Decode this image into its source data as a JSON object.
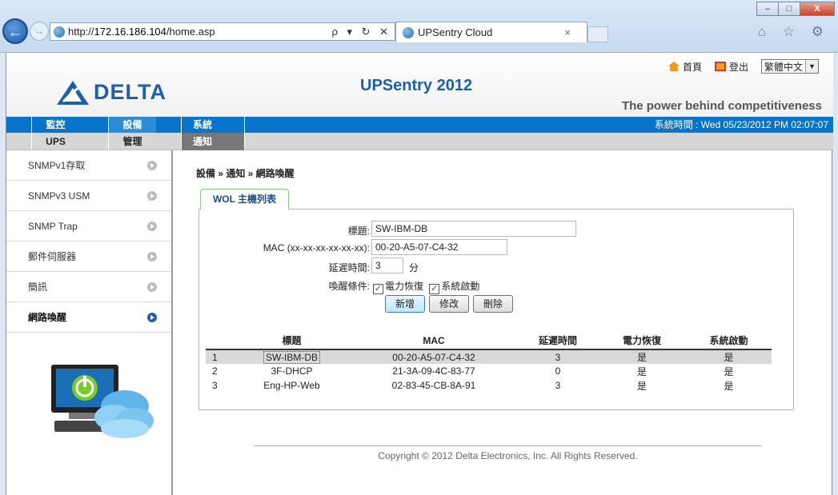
{
  "browser": {
    "url_prefix": "http://",
    "url_host": "172.16.186.104",
    "url_path": "/home.asp",
    "address_tools": "ρ ▾ ↻ ✕",
    "tab_title": "UPSentry Cloud",
    "tab_close": "×",
    "right_icons": "⌂ ☆ ⚙",
    "win_min": "–",
    "win_max": "□",
    "win_close": "X"
  },
  "header": {
    "logo_text": "DELTA",
    "app_title": "UPSentry 2012",
    "slogan": "The power behind competitiveness",
    "home_link": "首頁",
    "logout_link": "登出",
    "language": "繁體中文",
    "language_arrow": "▼"
  },
  "menu": {
    "items": [
      "監控",
      "設備",
      "系統"
    ],
    "active": "設備",
    "system_time": "系統時間 : Wed 05/23/2012 PM 02:07:07"
  },
  "submenu": {
    "items": [
      "UPS",
      "管理",
      "通知"
    ],
    "active": "通知"
  },
  "sidebar": {
    "items": [
      "SNMPv1存取",
      "SNMPv3 USM",
      "SNMP Trap",
      "郵件伺服器",
      "簡訊",
      "網路喚醒"
    ],
    "active": "網路喚醒"
  },
  "breadcrumb": "設備 » 通知 » 網路喚醒",
  "tab": {
    "label": "WOL 主機列表"
  },
  "form": {
    "title_label": "標題:",
    "title_value": "SW-IBM-DB",
    "mac_label": "MAC (xx-xx-xx-xx-xx-xx):",
    "mac_value": "00-20-A5-07-C4-32",
    "delay_label": "延遲時間:",
    "delay_value": "3",
    "delay_unit": "分",
    "wake_label": "喚醒條件:",
    "wake_power": "電力恢復",
    "wake_boot": "系統啟動",
    "wake_power_checked": true,
    "wake_boot_checked": true,
    "add_button": "新增",
    "edit_button": "修改",
    "delete_button": "刪除"
  },
  "table": {
    "headers": [
      "",
      "標題",
      "MAC",
      "延遲時間",
      "電力恢復",
      "系統啟動"
    ],
    "rows": [
      [
        "1",
        "SW-IBM-DB",
        "00-20-A5-07-C4-32",
        "3",
        "是",
        "是"
      ],
      [
        "2",
        "3F-DHCP",
        "21-3A-09-4C-83-77",
        "0",
        "是",
        "是"
      ],
      [
        "3",
        "Eng-HP-Web",
        "02-83-45-CB-8A-91",
        "3",
        "是",
        "是"
      ]
    ],
    "selected_row": 0
  },
  "footer": {
    "copyright": "Copyright © 2012 Delta Electronics, Inc. All Rights Reserved."
  },
  "colors": {
    "brand_blue": "#1b5fad",
    "menu_blue": "#0a74c9",
    "tab_green": "#8cc08c"
  }
}
